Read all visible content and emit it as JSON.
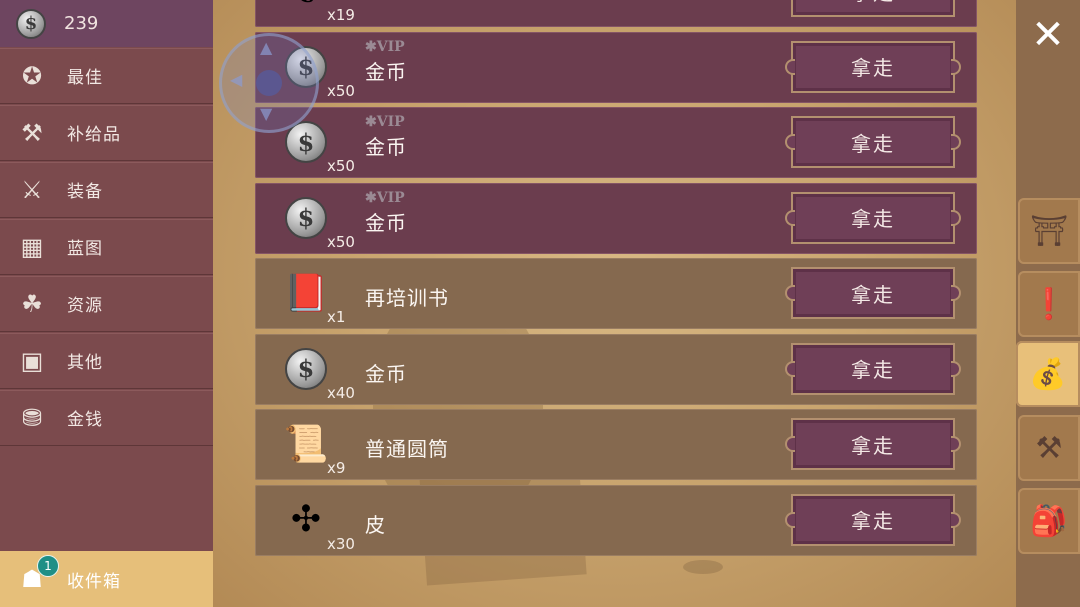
{
  "currency": {
    "icon": "silver-coin-icon",
    "amount": "239"
  },
  "sidebar": {
    "items": [
      {
        "label": "最佳",
        "icon": "star-badge-icon",
        "glyph": "✪"
      },
      {
        "label": "补给品",
        "icon": "hammer-wrench-icon",
        "glyph": "⚒"
      },
      {
        "label": "装备",
        "icon": "crossed-tools-icon",
        "glyph": "⚔"
      },
      {
        "label": "蓝图",
        "icon": "blueprint-icon",
        "glyph": "▦"
      },
      {
        "label": "资源",
        "icon": "logs-icon",
        "glyph": "☘"
      },
      {
        "label": "其他",
        "icon": "doorway-icon",
        "glyph": "▣"
      },
      {
        "label": "金钱",
        "icon": "coin-stack-icon",
        "glyph": "⛃"
      }
    ],
    "inbox": {
      "label": "收件箱",
      "icon": "chest-icon",
      "glyph": "☗",
      "badge": "1"
    }
  },
  "list": {
    "take_label": "拿走",
    "items": [
      {
        "name": "",
        "qty": "x19",
        "vip": "",
        "icon": "herb-bundle-icon",
        "variant": "purple",
        "glyph": "❦"
      },
      {
        "name": "金币",
        "qty": "x50",
        "vip": "✱VIP",
        "icon": "silver-coin-icon",
        "variant": "purple",
        "glyph": "$"
      },
      {
        "name": "金币",
        "qty": "x50",
        "vip": "✱VIP",
        "icon": "silver-coin-icon",
        "variant": "purple",
        "glyph": "$"
      },
      {
        "name": "金币",
        "qty": "x50",
        "vip": "✱VIP",
        "icon": "silver-coin-icon",
        "variant": "purple",
        "glyph": "$"
      },
      {
        "name": "再培训书",
        "qty": "x1",
        "vip": "",
        "icon": "red-book-icon",
        "variant": "tan",
        "glyph": "📕"
      },
      {
        "name": "金币",
        "qty": "x40",
        "vip": "",
        "icon": "silver-coin-icon",
        "variant": "tan",
        "glyph": "$"
      },
      {
        "name": "普通圆筒",
        "qty": "x9",
        "vip": "",
        "icon": "scroll-icon",
        "variant": "tan",
        "glyph": "📜"
      },
      {
        "name": "皮",
        "qty": "x30",
        "vip": "",
        "icon": "leather-hide-icon",
        "variant": "tan",
        "glyph": "✣"
      }
    ]
  },
  "right_rail": {
    "close": {
      "icon": "close-icon",
      "glyph": "✕"
    },
    "tabs": [
      {
        "icon": "workbench-icon",
        "glyph": "⛩",
        "active": false
      },
      {
        "icon": "quest-scroll-icon",
        "glyph": "❗",
        "active": false
      },
      {
        "icon": "loot-sack-icon",
        "glyph": "💰",
        "active": true
      },
      {
        "icon": "anvil-icon",
        "glyph": "⚒",
        "active": false
      },
      {
        "icon": "backpack-icon",
        "glyph": "🎒",
        "active": false
      }
    ]
  },
  "joystick": {
    "icon": "joystick-icon"
  }
}
